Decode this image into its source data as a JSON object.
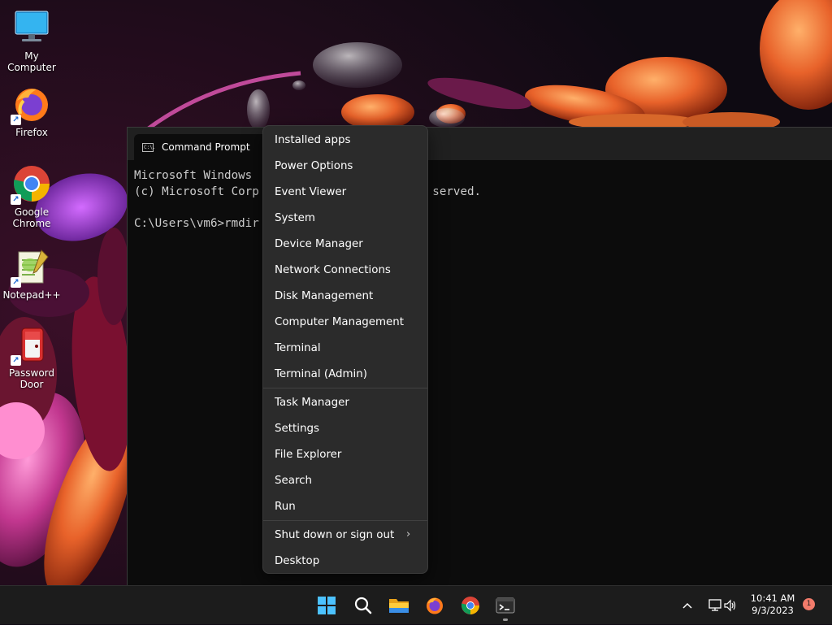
{
  "desktop": {
    "icons": [
      {
        "label": "My Computer",
        "icon": "monitor-icon"
      },
      {
        "label": "Firefox",
        "icon": "firefox-icon"
      },
      {
        "label": "Google Chrome",
        "icon": "chrome-icon"
      },
      {
        "label": "Notepad++",
        "icon": "notepadpp-icon"
      },
      {
        "label": "Password Door",
        "icon": "password-door-icon"
      }
    ]
  },
  "cmd": {
    "title": "Command Prompt",
    "icon": "cmd-icon",
    "icon_text": "C:\\.",
    "lines": [
      "Microsoft Windows",
      "(c) Microsoft Corp                         served.",
      "",
      "C:\\Users\\vm6>rmdir"
    ]
  },
  "context_menu": {
    "group1": [
      "Installed apps",
      "Power Options",
      "Event Viewer",
      "System",
      "Device Manager",
      "Network Connections",
      "Disk Management",
      "Computer Management",
      "Terminal",
      "Terminal (Admin)"
    ],
    "group2": [
      "Task Manager",
      "Settings",
      "File Explorer",
      "Search",
      "Run"
    ],
    "group3": [
      "Shut down or sign out",
      "Desktop"
    ],
    "submenu_icon": "chevron-right-icon"
  },
  "taskbar": {
    "apps": [
      "start-icon",
      "search-icon",
      "file-explorer-icon",
      "firefox-icon",
      "chrome-icon",
      "terminal-icon"
    ],
    "tray": [
      "chevron-up-icon",
      "network-icon",
      "volume-icon"
    ],
    "time": "10:41 AM",
    "date": "9/3/2023",
    "notification_count": "1"
  },
  "colors": {
    "menu_bg": "#2b2b2b",
    "taskbar_bg": "#1c1c1c",
    "console_bg": "#0c0c0c",
    "console_text": "#cccccc",
    "badge": "#f27b6b"
  }
}
